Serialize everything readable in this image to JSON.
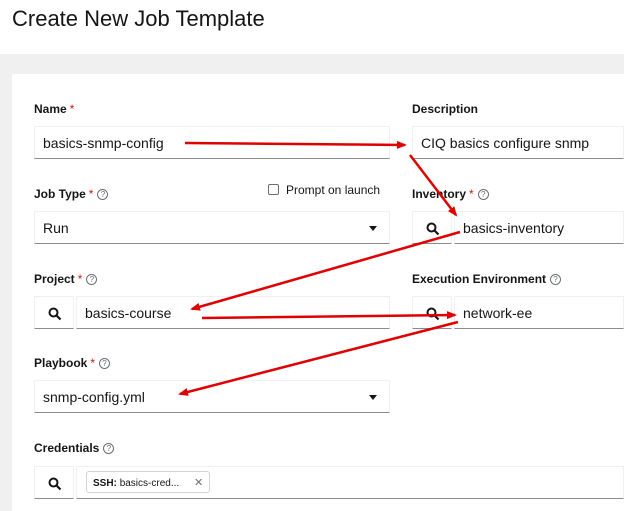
{
  "page": {
    "title": "Create New Job Template"
  },
  "form": {
    "name": {
      "label": "Name",
      "required": "*",
      "value": "basics-snmp-config"
    },
    "description": {
      "label": "Description",
      "value": "CIQ basics configure snmp"
    },
    "job_type": {
      "label": "Job Type",
      "required": "*",
      "value": "Run",
      "prompt_label": "Prompt on launch",
      "prompt_checked": false
    },
    "inventory": {
      "label": "Inventory",
      "required": "*",
      "value": "basics-inventory"
    },
    "project": {
      "label": "Project",
      "required": "*",
      "value": "basics-course"
    },
    "execution_environment": {
      "label": "Execution Environment",
      "value": "network-ee"
    },
    "playbook": {
      "label": "Playbook",
      "required": "*",
      "value": "snmp-config.yml"
    },
    "credentials": {
      "label": "Credentials",
      "chip_type": "SSH:",
      "chip_value": "basics-cred...",
      "chip_remove": "✕"
    },
    "help_glyph": "?"
  },
  "annotations": {
    "arrow_color": "#e00000"
  },
  "icons": [
    "search-icon",
    "help-icon",
    "caret-down-icon",
    "close-icon"
  ]
}
